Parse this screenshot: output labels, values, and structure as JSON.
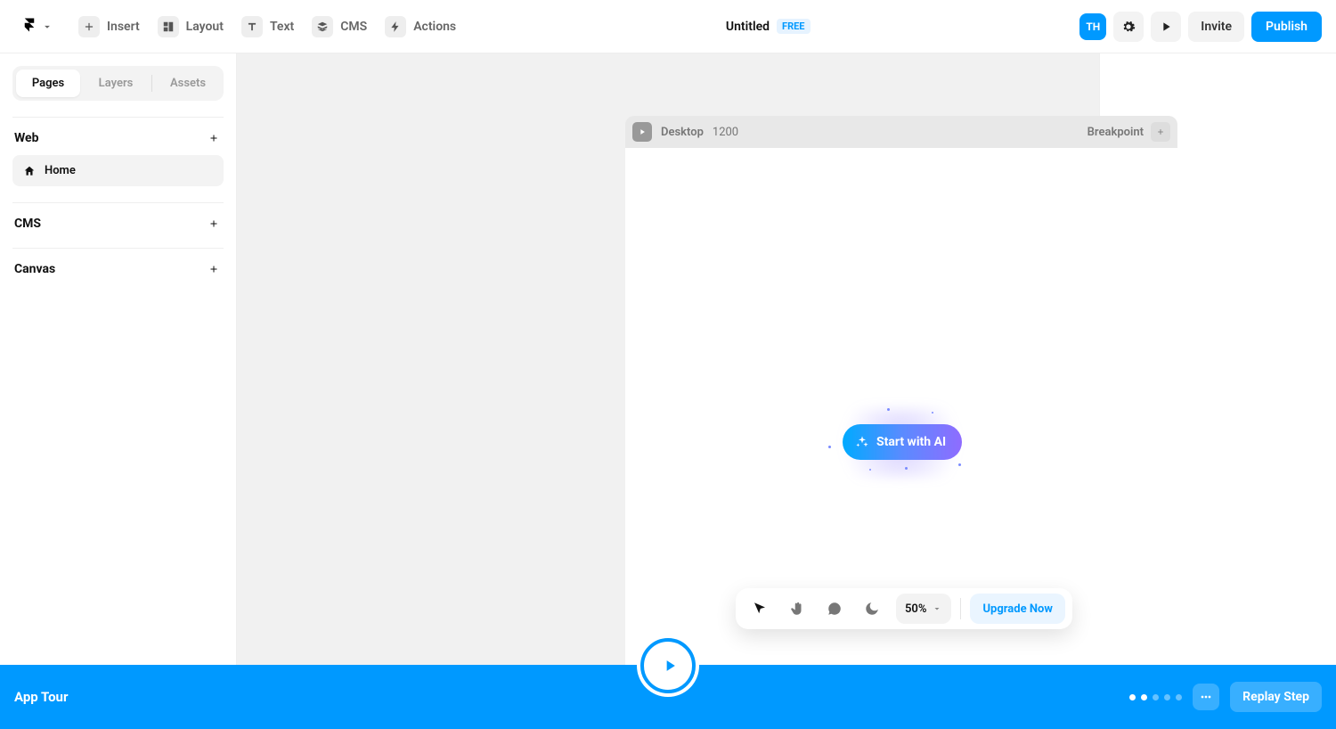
{
  "topbar": {
    "menu": [
      {
        "icon": "plus",
        "label": "Insert"
      },
      {
        "icon": "layout",
        "label": "Layout"
      },
      {
        "icon": "text",
        "label": "Text"
      },
      {
        "icon": "stack",
        "label": "CMS"
      },
      {
        "icon": "bolt",
        "label": "Actions"
      }
    ],
    "project_title": "Untitled",
    "plan_badge": "FREE",
    "avatar": "TH",
    "invite_label": "Invite",
    "publish_label": "Publish"
  },
  "sidebar": {
    "tabs": [
      "Pages",
      "Layers",
      "Assets"
    ],
    "active_tab": 0,
    "sections": {
      "web": {
        "title": "Web"
      },
      "cms": {
        "title": "CMS"
      },
      "canvas": {
        "title": "Canvas"
      }
    },
    "pages": [
      {
        "label": "Home"
      }
    ]
  },
  "canvas": {
    "breakpoint_device": "Desktop",
    "breakpoint_width": "1200",
    "breakpoint_label": "Breakpoint",
    "ai_button": "Start with AI"
  },
  "bottom": {
    "zoom": "50%",
    "upgrade": "Upgrade Now"
  },
  "tour": {
    "title": "App Tour",
    "step_count": 5,
    "current_step": 2,
    "replay": "Replay Step"
  },
  "colors": {
    "accent": "#0099ff"
  }
}
